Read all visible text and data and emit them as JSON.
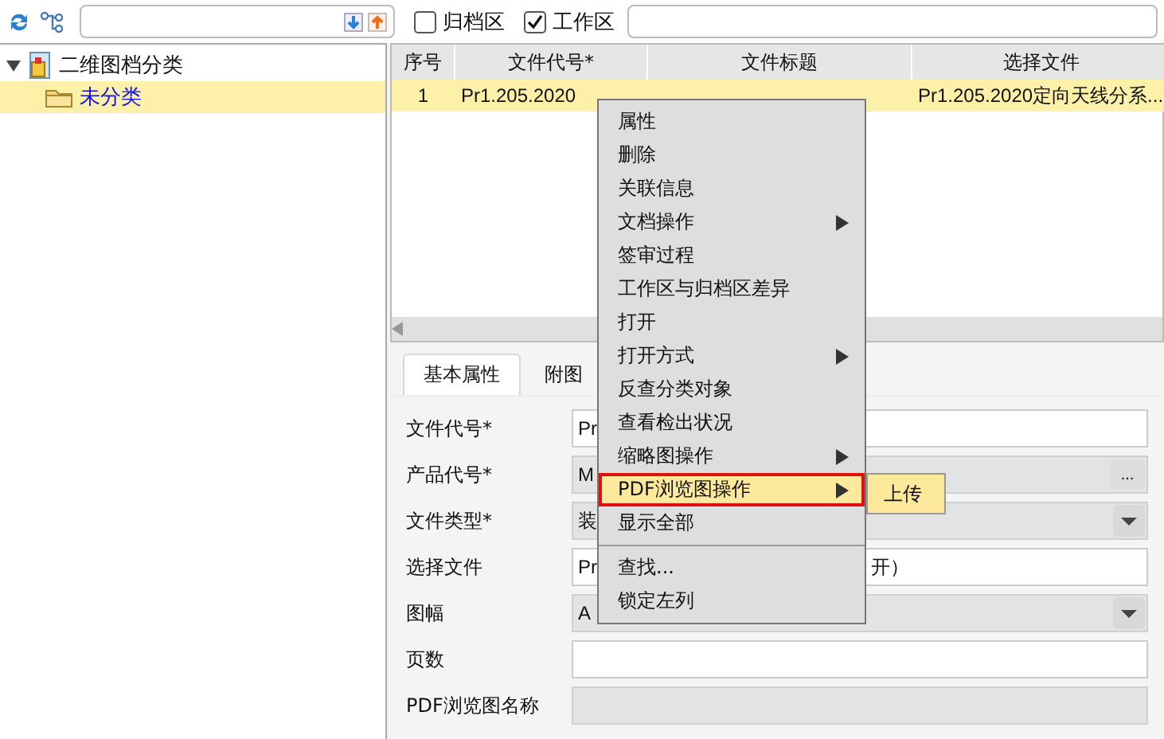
{
  "toolbar": {
    "filters": [
      {
        "label": "归档区",
        "checked": false
      },
      {
        "label": "工作区",
        "checked": true
      }
    ]
  },
  "tree": [
    {
      "label": "二维图档分类",
      "expanded": true,
      "selected": false,
      "children": [
        {
          "label": "未分类",
          "selected": true
        }
      ]
    }
  ],
  "table": {
    "columns": [
      "序号",
      "文件代号*",
      "文件标题",
      "选择文件"
    ],
    "rows": [
      {
        "cells": [
          "1",
          "Pr1.205.2020",
          null,
          "Pr1.205.2020定向天线分系..."
        ],
        "selected": true
      }
    ]
  },
  "tabs": [
    {
      "label": "基本属性",
      "selected": true
    },
    {
      "label": "附图",
      "selected": false
    }
  ],
  "form": [
    {
      "label": "文件代号*",
      "kind": "text",
      "value": "Pr",
      "disabled": false
    },
    {
      "label": "产品代号*",
      "kind": "picker",
      "value": "M",
      "disabled": true,
      "button": "..."
    },
    {
      "label": "文件类型*",
      "kind": "select",
      "value": "装",
      "disabled": true
    },
    {
      "label": "选择文件",
      "kind": "text",
      "value": "Pr",
      "value_end": "开）",
      "disabled": false
    },
    {
      "label": "图幅",
      "kind": "select",
      "value": "A",
      "disabled": true
    },
    {
      "label": "页数",
      "kind": "text",
      "disabled": false
    },
    {
      "label": "PDF浏览图名称",
      "kind": "text",
      "disabled": true
    }
  ],
  "context_menu": [
    {
      "kind": "item",
      "label": "属性",
      "submenu": false,
      "selected": false
    },
    {
      "kind": "item",
      "label": "删除",
      "submenu": false,
      "selected": false
    },
    {
      "kind": "item",
      "label": "关联信息",
      "submenu": false,
      "selected": false
    },
    {
      "kind": "item",
      "label": "文档操作",
      "submenu": true,
      "selected": false
    },
    {
      "kind": "item",
      "label": "签审过程",
      "submenu": false,
      "selected": false
    },
    {
      "kind": "item",
      "label": "工作区与归档区差异",
      "submenu": false,
      "selected": false
    },
    {
      "kind": "item",
      "label": "打开",
      "submenu": false,
      "selected": false
    },
    {
      "kind": "item",
      "label": "打开方式",
      "submenu": true,
      "selected": false
    },
    {
      "kind": "item",
      "label": "反查分类对象",
      "submenu": false,
      "selected": false
    },
    {
      "kind": "item",
      "label": "查看检出状况",
      "submenu": false,
      "selected": false
    },
    {
      "kind": "item",
      "label": "缩略图操作",
      "submenu": true,
      "selected": false
    },
    {
      "kind": "item",
      "label": "PDF浏览图操作",
      "submenu": true,
      "selected": true,
      "children": [
        {
          "label": "上传",
          "selected": true
        }
      ]
    },
    {
      "kind": "item",
      "label": "显示全部",
      "submenu": false,
      "selected": false
    },
    {
      "kind": "separator"
    },
    {
      "kind": "item",
      "label": "查找...",
      "submenu": false,
      "selected": false
    },
    {
      "kind": "item",
      "label": "锁定左列",
      "submenu": false,
      "selected": false
    }
  ]
}
